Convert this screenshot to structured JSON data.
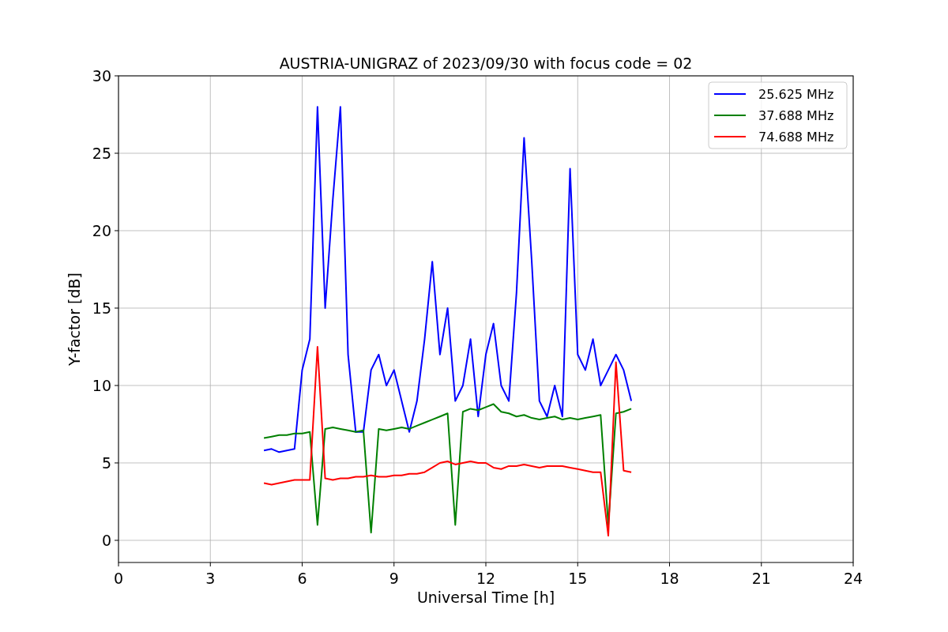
{
  "chart_data": {
    "type": "line",
    "title": "AUSTRIA-UNIGRAZ of 2023/09/30 with focus code = 02",
    "xlabel": "Universal Time [h]",
    "ylabel": "Y-factor [dB]",
    "x": [
      4.75,
      5,
      5.25,
      5.5,
      5.75,
      6,
      6.25,
      6.5,
      6.75,
      7,
      7.25,
      7.5,
      7.75,
      8,
      8.25,
      8.5,
      8.75,
      9,
      9.25,
      9.5,
      9.75,
      10,
      10.25,
      10.5,
      10.75,
      11,
      11.25,
      11.5,
      11.75,
      12,
      12.25,
      12.5,
      12.75,
      13,
      13.25,
      13.5,
      13.75,
      14,
      14.25,
      14.5,
      14.75,
      15,
      15.25,
      15.5,
      15.75,
      16,
      16.25,
      16.5,
      16.75
    ],
    "series": [
      {
        "name": "25.625 MHz",
        "color": "#0000ff",
        "values": [
          5.8,
          5.9,
          5.7,
          5.8,
          5.9,
          11,
          13,
          28,
          15,
          22,
          28,
          12,
          7,
          7,
          11,
          12,
          10,
          11,
          9,
          7,
          9,
          13,
          18,
          12,
          15,
          9,
          10,
          13,
          8,
          12,
          14,
          10,
          9,
          16,
          26,
          18,
          9,
          8,
          10,
          8,
          24,
          12,
          11,
          13,
          10,
          11,
          12,
          11,
          9
        ]
      },
      {
        "name": "37.688 MHz",
        "color": "#008000",
        "values": [
          6.6,
          6.7,
          6.8,
          6.8,
          6.9,
          6.9,
          7.0,
          1.0,
          7.2,
          7.3,
          7.2,
          7.1,
          7.0,
          7.1,
          0.5,
          7.2,
          7.1,
          7.2,
          7.3,
          7.2,
          7.4,
          7.6,
          7.8,
          8.0,
          8.2,
          1.0,
          8.3,
          8.5,
          8.4,
          8.6,
          8.8,
          8.3,
          8.2,
          8.0,
          8.1,
          7.9,
          7.8,
          7.9,
          8.0,
          7.8,
          7.9,
          7.8,
          7.9,
          8.0,
          8.1,
          1.0,
          8.2,
          8.3,
          8.5
        ]
      },
      {
        "name": "74.688 MHz",
        "color": "#ff0000",
        "values": [
          3.7,
          3.6,
          3.7,
          3.8,
          3.9,
          3.9,
          3.9,
          12.5,
          4.0,
          3.9,
          4.0,
          4.0,
          4.1,
          4.1,
          4.2,
          4.1,
          4.1,
          4.2,
          4.2,
          4.3,
          4.3,
          4.4,
          4.7,
          5.0,
          5.1,
          4.9,
          5.0,
          5.1,
          5.0,
          5.0,
          4.7,
          4.6,
          4.8,
          4.8,
          4.9,
          4.8,
          4.7,
          4.8,
          4.8,
          4.8,
          4.7,
          4.6,
          4.5,
          4.4,
          4.4,
          0.3,
          11.5,
          4.5,
          4.4
        ]
      }
    ],
    "xlim": [
      0,
      24
    ],
    "ylim": [
      -1.43,
      30
    ],
    "xticks": [
      0,
      3,
      6,
      9,
      12,
      15,
      18,
      21,
      24
    ],
    "yticks": [
      0,
      5,
      10,
      15,
      20,
      25,
      30
    ],
    "grid": true,
    "legend": true
  }
}
